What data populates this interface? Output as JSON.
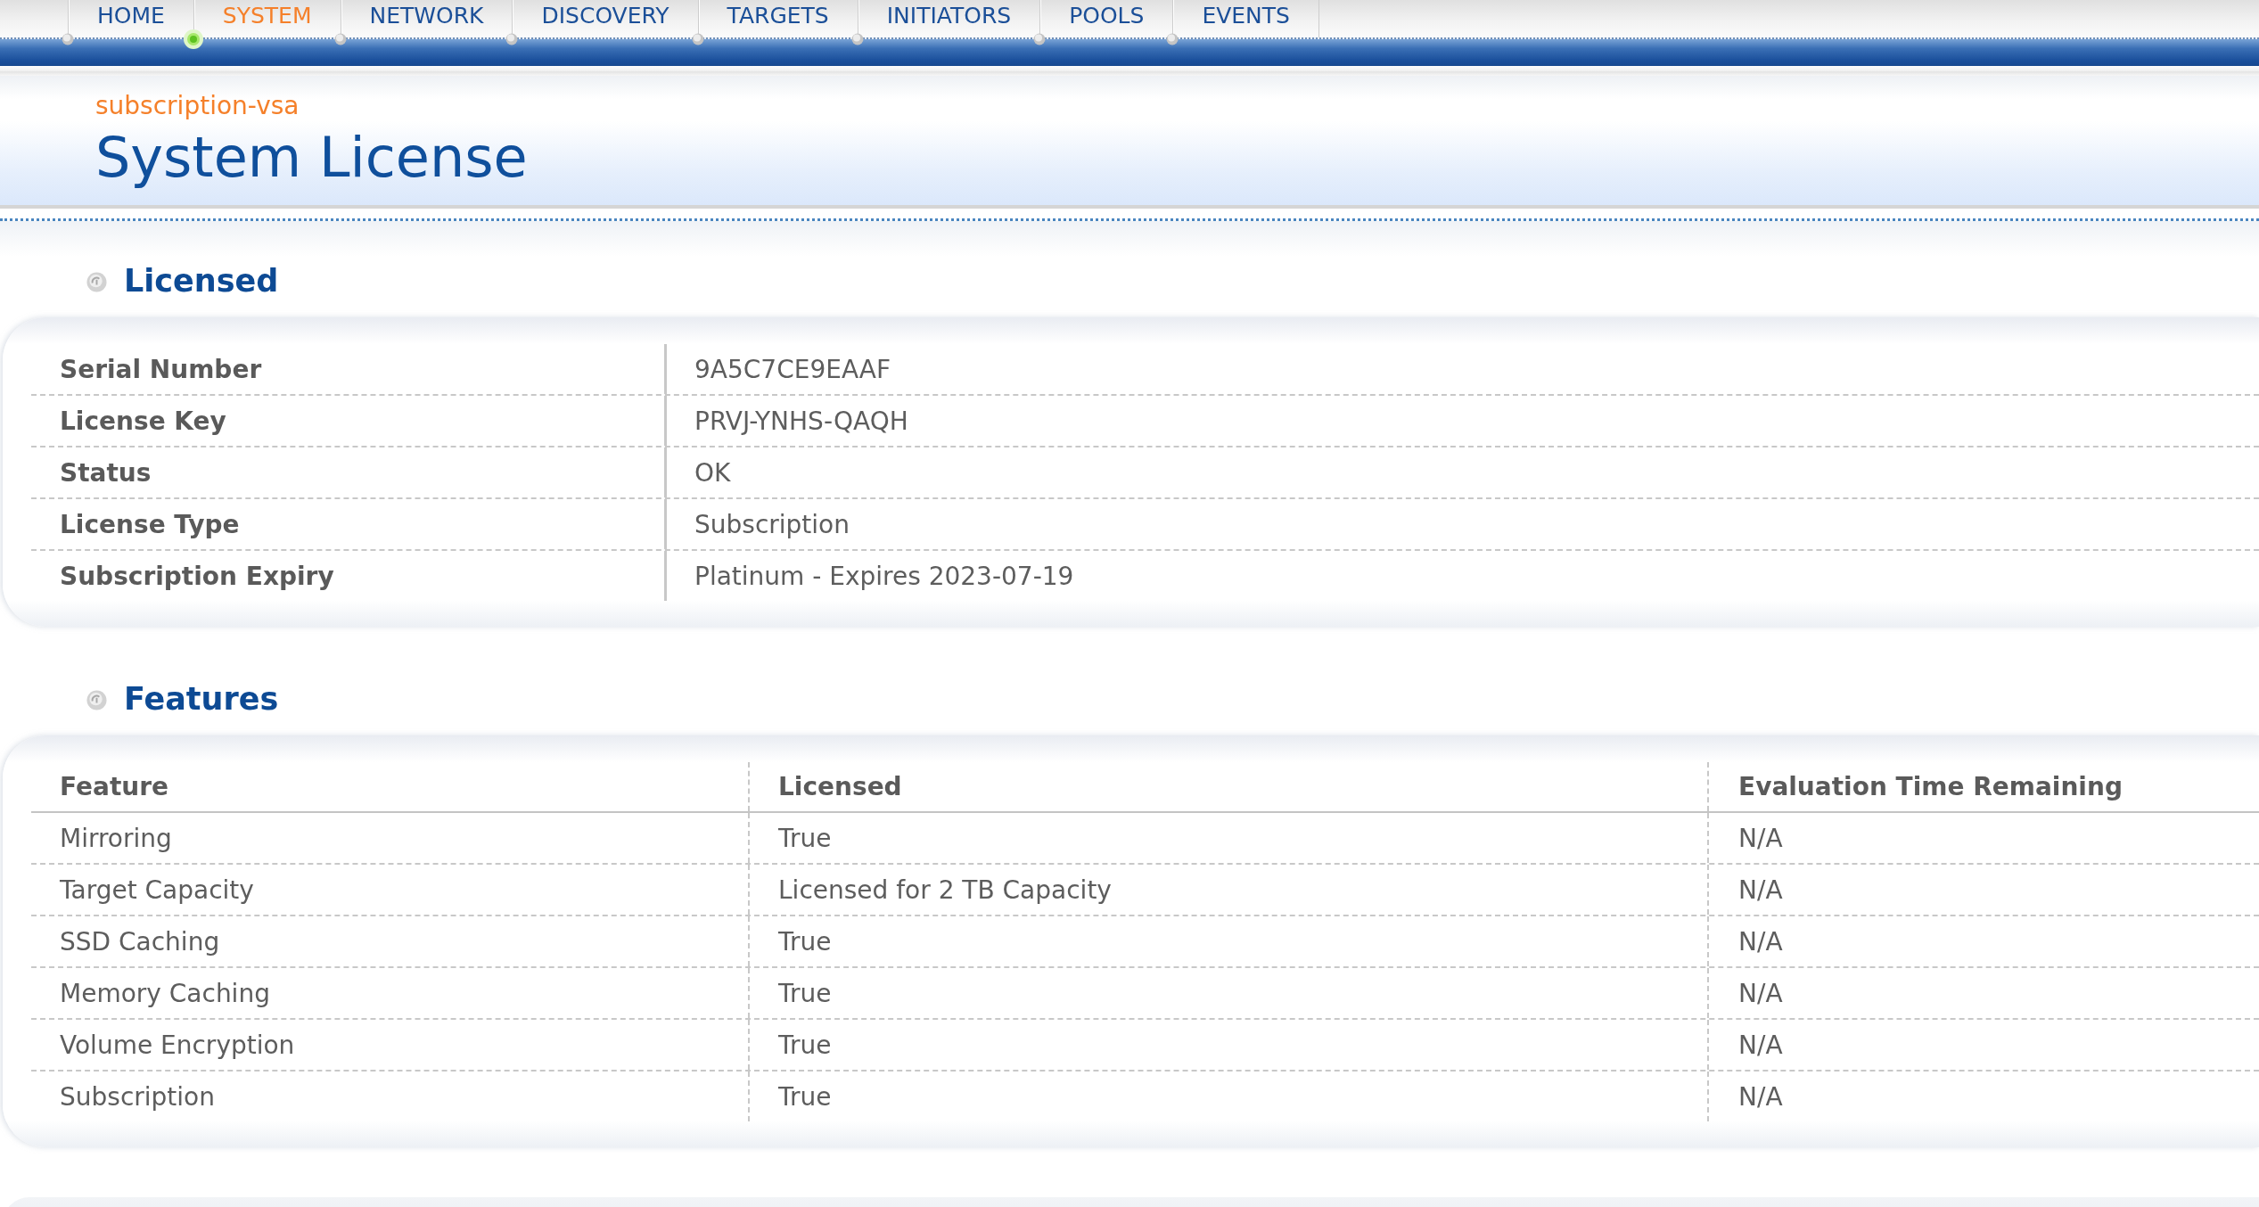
{
  "nav": {
    "items": [
      {
        "label": "HOME",
        "selected": false
      },
      {
        "label": "SYSTEM",
        "selected": true
      },
      {
        "label": "NETWORK",
        "selected": false
      },
      {
        "label": "DISCOVERY",
        "selected": false
      },
      {
        "label": "TARGETS",
        "selected": false
      },
      {
        "label": "INITIATORS",
        "selected": false
      },
      {
        "label": "POOLS",
        "selected": false
      },
      {
        "label": "EVENTS",
        "selected": false
      }
    ]
  },
  "header": {
    "subtitle": "subscription-vsa",
    "title": "System License"
  },
  "sections": [
    {
      "kind": "properties",
      "title": "Licensed",
      "rows": [
        {
          "label": "Serial Number",
          "value": "9A5C7CE9EAAF"
        },
        {
          "label": "License Key",
          "value": "PRVJ-YNHS-QAQH"
        },
        {
          "label": "Status",
          "value": "OK"
        },
        {
          "label": "License Type",
          "value": "Subscription"
        },
        {
          "label": "Subscription Expiry",
          "value": "Platinum - Expires 2023-07-19"
        }
      ]
    },
    {
      "kind": "table",
      "title": "Features",
      "columns": [
        "Feature",
        "Licensed",
        "Evaluation Time Remaining"
      ],
      "rows": [
        [
          "Mirroring",
          "True",
          "N/A"
        ],
        [
          "Target Capacity",
          "Licensed for 2 TB Capacity",
          "N/A"
        ],
        [
          "SSD Caching",
          "True",
          "N/A"
        ],
        [
          "Memory Caching",
          "True",
          "N/A"
        ],
        [
          "Volume Encryption",
          "True",
          "N/A"
        ],
        [
          "Subscription",
          "True",
          "N/A"
        ]
      ]
    }
  ]
}
